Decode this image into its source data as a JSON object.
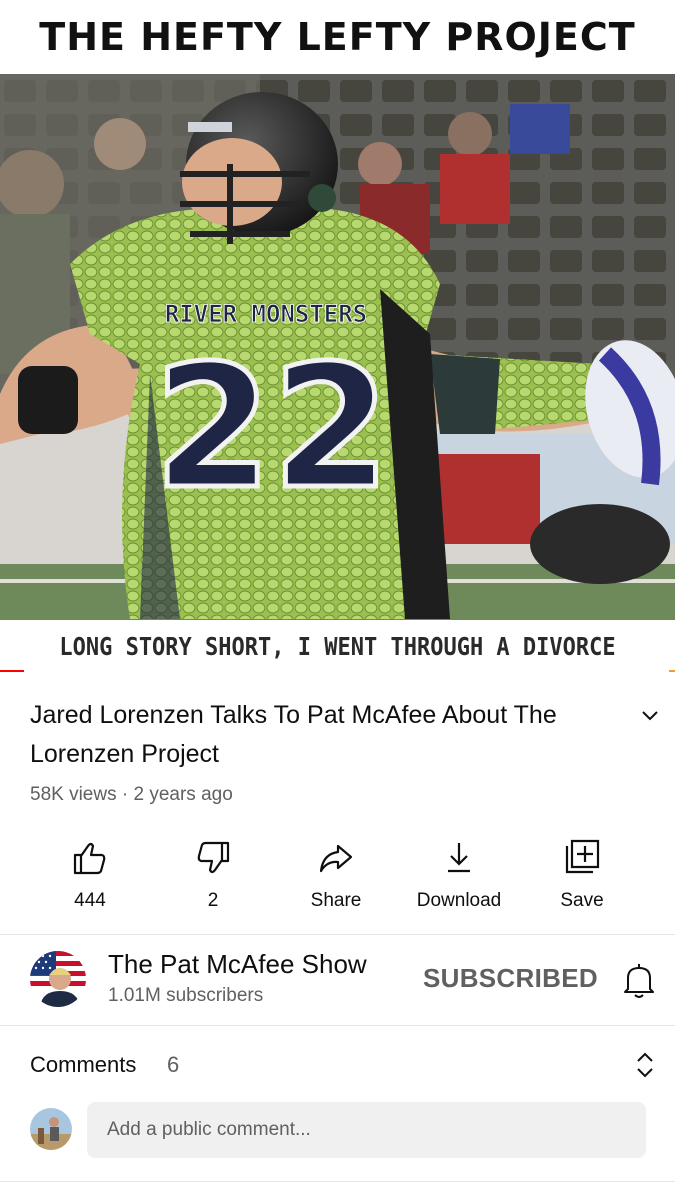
{
  "video": {
    "overlay_title": "THE HEFTY LEFTY PROJECT",
    "overlay_caption": "LONG STORY SHORT, I WENT THROUGH A DIVORCE",
    "jersey_team": "RIVER MONSTERS",
    "jersey_number": "22",
    "progress_fraction": 0.035
  },
  "info": {
    "title": "Jared Lorenzen Talks To Pat McAfee About The Lorenzen Project",
    "views": "58K views",
    "age": "2 years ago"
  },
  "actions": {
    "like_count": "444",
    "dislike_count": "2",
    "share_label": "Share",
    "download_label": "Download",
    "save_label": "Save"
  },
  "channel": {
    "name": "The Pat McAfee Show",
    "subscribers": "1.01M subscribers",
    "subscribe_status": "SUBSCRIBED"
  },
  "comments": {
    "label": "Comments",
    "count": "6",
    "placeholder": "Add a public comment..."
  },
  "colors": {
    "accent_red": "#ff0000",
    "secondary_text": "#606060",
    "jersey_green": "#a6c85a",
    "jersey_navy": "#1e2545"
  },
  "icons": [
    "thumbs-up-icon",
    "thumbs-down-icon",
    "share-icon",
    "download-icon",
    "save-playlist-icon",
    "chevron-down-icon",
    "bell-icon",
    "expand-collapse-icon"
  ]
}
